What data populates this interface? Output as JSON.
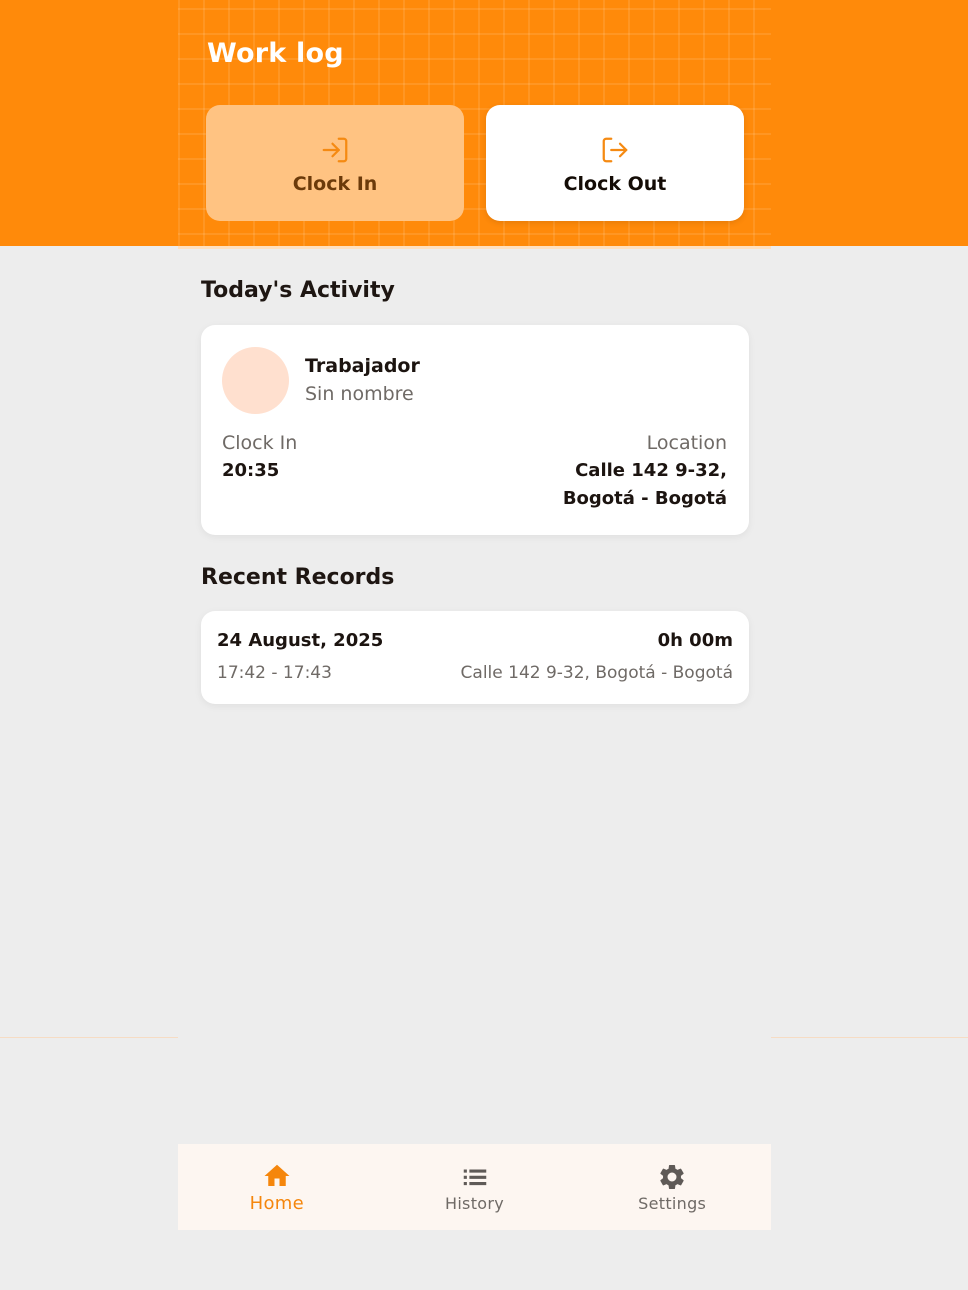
{
  "app": {
    "title": "Work log",
    "accent_color": "#ff8a0a"
  },
  "actions": {
    "clock_in": {
      "label": "Clock In",
      "icon": "login-icon"
    },
    "clock_out": {
      "label": "Clock Out",
      "icon": "logout-icon"
    }
  },
  "today": {
    "section_title": "Today's Activity",
    "worker_name": "Trabajador",
    "worker_subtitle": "Sin nombre",
    "clock_in_label": "Clock In",
    "clock_in_value": "20:35",
    "location_label": "Location",
    "location_line1": "Calle 142 9-32,",
    "location_line2": "Bogotá - Bogotá"
  },
  "recent": {
    "section_title": "Recent Records",
    "records": [
      {
        "date": "24 August, 2025",
        "duration": "0h 00m",
        "time_range": "17:42 - 17:43",
        "location": "Calle 142 9-32, Bogotá - Bogotá"
      }
    ]
  },
  "nav": {
    "items": [
      {
        "label": "Home",
        "icon": "home-icon",
        "active": true
      },
      {
        "label": "History",
        "icon": "list-icon",
        "active": false
      },
      {
        "label": "Settings",
        "icon": "gear-icon",
        "active": false
      }
    ]
  }
}
